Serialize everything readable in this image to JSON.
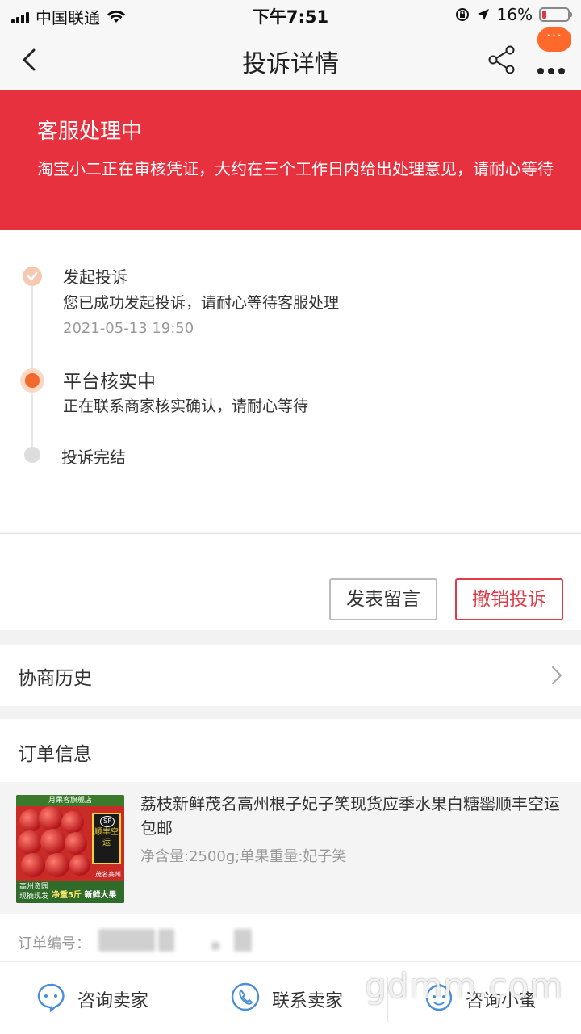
{
  "status_bar": {
    "carrier": "中国联通",
    "time": "下午7:51",
    "battery": "16%",
    "battery_level": 0.16
  },
  "nav": {
    "title": "投诉详情",
    "message_badge": "···"
  },
  "banner": {
    "title": "客服处理中",
    "description": "淘宝小二正在审核凭证，大约在三个工作日内给出处理意见，请耐心等待"
  },
  "progress": {
    "steps": [
      {
        "title": "发起投诉",
        "desc": "您已成功发起投诉，请耐心等待客服处理",
        "time": "2021-05-13 19:50",
        "state": "done"
      },
      {
        "title": "平台核实中",
        "desc": "正在联系商家核实确认，请耐心等待",
        "state": "current"
      },
      {
        "title": "投诉完结",
        "state": "pending"
      }
    ],
    "colors": {
      "done": "#f5c9b0",
      "current": "#f26a2b",
      "pending": "#dddddd"
    }
  },
  "actions": {
    "leave_message": "发表留言",
    "cancel_complaint": "撤销投诉"
  },
  "history": {
    "label": "协商历史"
  },
  "order": {
    "title": "订单信息",
    "product": {
      "name": "荔枝新鲜茂名高州根子妃子笑现货应季水果白糖罂顺丰空运包邮",
      "spec": "净含量:2500g;单果重量:妃子笑",
      "image": {
        "store": "月果客旗舰店",
        "badge": "顺丰空运",
        "badge_logo": "SF",
        "origin": "茂名高州",
        "footer_line1": "高州资园",
        "footer_line2": "现摘现发",
        "weight": "净重5斤",
        "tagline": "新鲜大果"
      }
    },
    "order_no_label": "订单编号："
  },
  "bottom_bar": {
    "tabs": [
      {
        "label": "咨询卖家",
        "icon": "chat-bubble-icon"
      },
      {
        "label": "联系卖家",
        "icon": "phone-icon"
      },
      {
        "label": "咨询小蜜",
        "icon": "assistant-face-icon"
      }
    ]
  },
  "watermark": "gdmm.com",
  "theme": {
    "accent_red": "#e8313f",
    "orange": "#f26a2b",
    "icon_blue": "#4a8fd6"
  }
}
